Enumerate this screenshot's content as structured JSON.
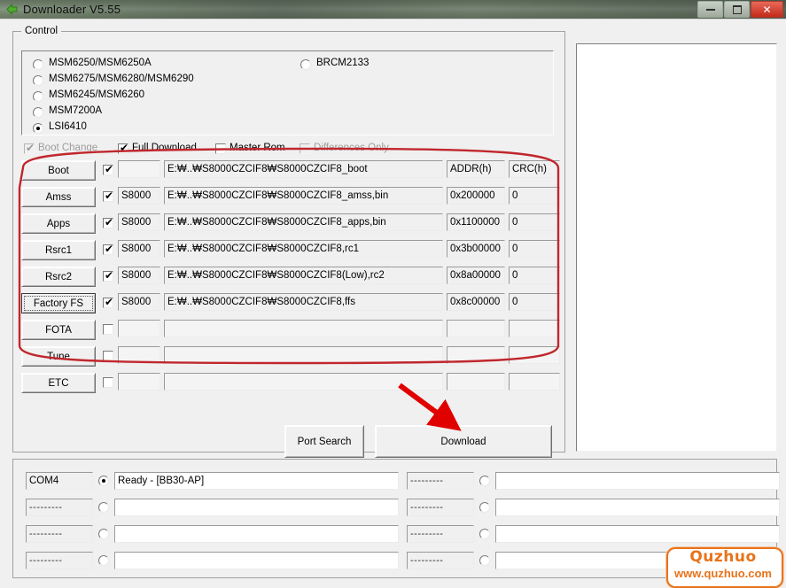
{
  "window": {
    "title": "Downloader V5.55",
    "icon": "green-left-arrow-icon",
    "minimize_label": "–",
    "maximize_label": "□",
    "close_label": "✕"
  },
  "control_group": {
    "legend": "Control",
    "chipsets_left": [
      {
        "label": "MSM6250/MSM6250A",
        "selected": false
      },
      {
        "label": "MSM6275/MSM6280/MSM6290",
        "selected": false
      },
      {
        "label": "MSM6245/MSM6260",
        "selected": false
      },
      {
        "label": "MSM7200A",
        "selected": false
      },
      {
        "label": "LSI6410",
        "selected": true
      }
    ],
    "chipsets_right": [
      {
        "label": "BRCM2133",
        "selected": false
      }
    ]
  },
  "options": [
    {
      "label": "Boot Change",
      "checked": true,
      "disabled": true
    },
    {
      "label": "Full Download",
      "checked": true,
      "disabled": false
    },
    {
      "label": "Master Rom",
      "checked": false,
      "disabled": false
    },
    {
      "label": "Differences Only",
      "checked": false,
      "disabled": true
    }
  ],
  "file_table": {
    "headers": {
      "addr": "ADDR(h)",
      "crc": "CRC(h)"
    },
    "rows": [
      {
        "button": "Boot",
        "checked": true,
        "focused": false,
        "model": "",
        "path": "E:₩..₩S8000CZCIF8₩S8000CZCIF8_boot",
        "addr": "",
        "crc": "",
        "header_row": true
      },
      {
        "button": "Amss",
        "checked": true,
        "focused": false,
        "model": "S8000",
        "path": "E:₩..₩S8000CZCIF8₩S8000CZCIF8_amss,bin",
        "addr": "0x200000",
        "crc": "0",
        "header_row": false
      },
      {
        "button": "Apps",
        "checked": true,
        "focused": false,
        "model": "S8000",
        "path": "E:₩..₩S8000CZCIF8₩S8000CZCIF8_apps,bin",
        "addr": "0x1100000",
        "crc": "0",
        "header_row": false
      },
      {
        "button": "Rsrc1",
        "checked": true,
        "focused": false,
        "model": "S8000",
        "path": "E:₩..₩S8000CZCIF8₩S8000CZCIF8,rc1",
        "addr": "0x3b00000",
        "crc": "0",
        "header_row": false
      },
      {
        "button": "Rsrc2",
        "checked": true,
        "focused": false,
        "model": "S8000",
        "path": "E:₩..₩S8000CZCIF8₩S8000CZCIF8(Low),rc2",
        "addr": "0x8a00000",
        "crc": "0",
        "header_row": false
      },
      {
        "button": "Factory FS",
        "checked": true,
        "focused": true,
        "model": "S8000",
        "path": "E:₩..₩S8000CZCIF8₩S8000CZCIF8,ffs",
        "addr": "0x8c00000",
        "crc": "0",
        "header_row": false
      },
      {
        "button": "FOTA",
        "checked": false,
        "focused": false,
        "model": "",
        "path": "",
        "addr": "",
        "crc": "",
        "header_row": false
      },
      {
        "button": "Tune",
        "checked": false,
        "focused": false,
        "model": "",
        "path": "",
        "addr": "",
        "crc": "",
        "header_row": false
      },
      {
        "button": "ETC",
        "checked": false,
        "focused": false,
        "model": "",
        "path": "",
        "addr": "",
        "crc": "",
        "header_row": false
      }
    ]
  },
  "actions": {
    "port_search": "Port Search",
    "download": "Download"
  },
  "log_panel": {
    "content": ""
  },
  "status": {
    "ports_left": [
      {
        "port": "COM4",
        "selected": true,
        "message": "Ready - [BB30-AP]"
      },
      {
        "port": "---------",
        "selected": false,
        "message": ""
      },
      {
        "port": "---------",
        "selected": false,
        "message": ""
      },
      {
        "port": "---------",
        "selected": false,
        "message": ""
      }
    ],
    "ports_right": [
      {
        "port": "---------",
        "selected": false,
        "message": ""
      },
      {
        "port": "---------",
        "selected": false,
        "message": ""
      },
      {
        "port": "---------",
        "selected": false,
        "message": ""
      },
      {
        "port": "---------",
        "selected": false,
        "message": ""
      }
    ]
  },
  "annotations": {
    "highlight_color": "#c0272d",
    "arrow_color": "#e00000",
    "oval_name": "red-oval-highlight",
    "arrow_name": "red-arrow-pointing-to-download"
  },
  "watermark": {
    "brand": "Quzhuo",
    "url": "www.quzhuo.com",
    "color": "#e8731a"
  }
}
